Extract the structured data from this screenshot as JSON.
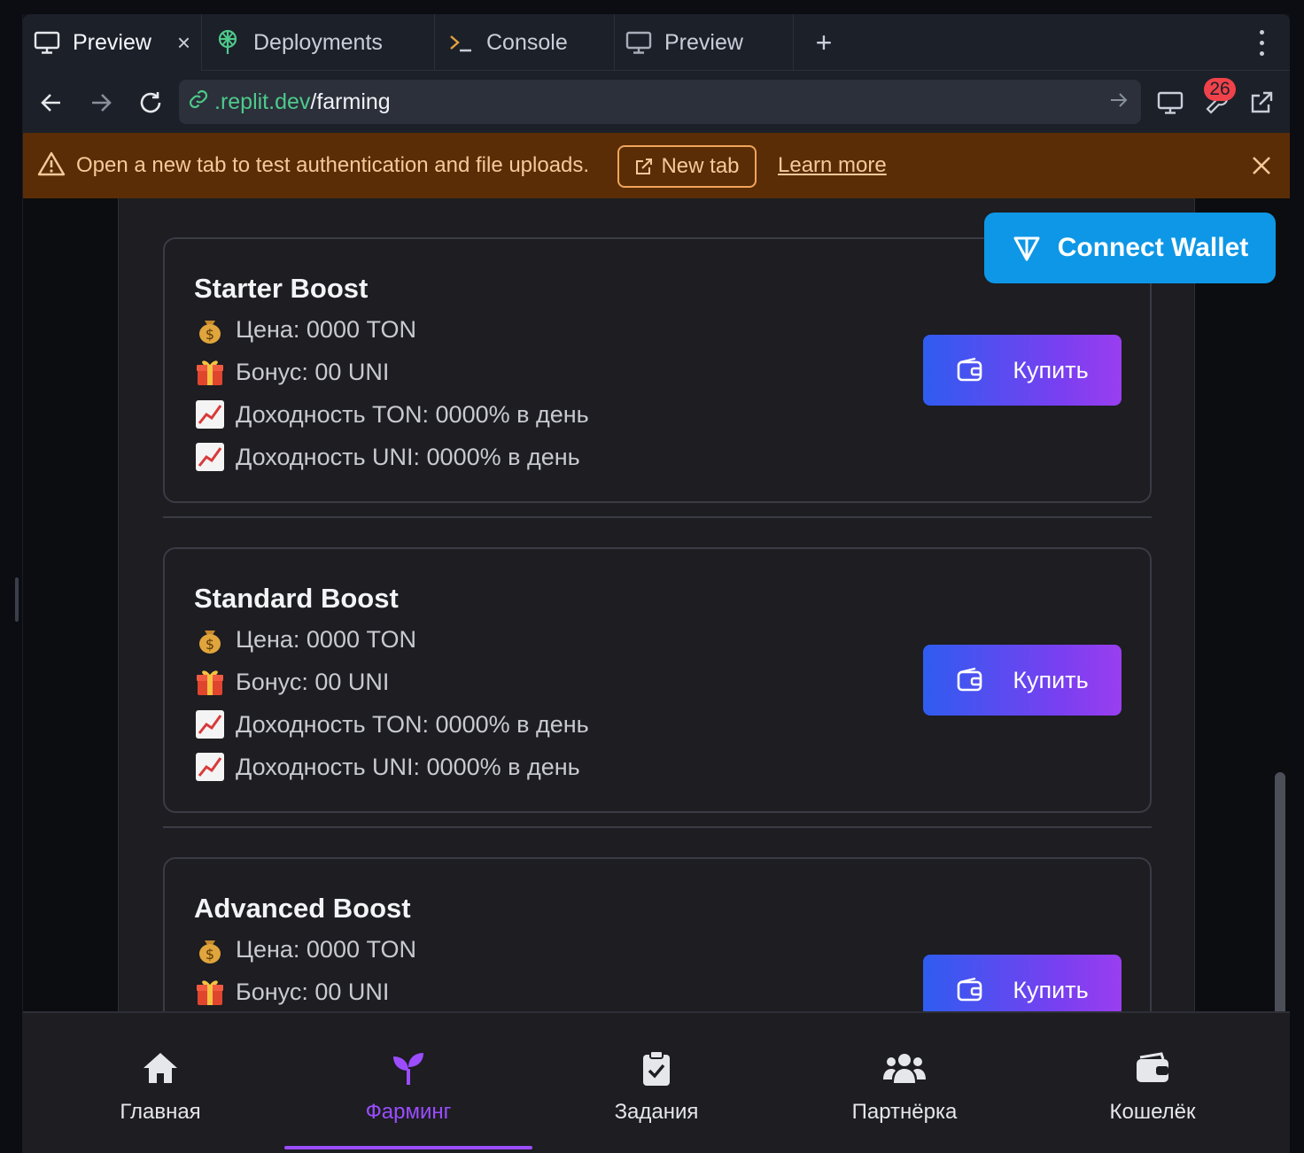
{
  "ide": {
    "tabs": [
      {
        "label": "Preview",
        "icon": "monitor-icon",
        "active": true
      },
      {
        "label": "Deployments",
        "icon": "deployments-icon"
      },
      {
        "label": "Console",
        "icon": "terminal-icon"
      },
      {
        "label": "Preview",
        "icon": "monitor-icon"
      }
    ],
    "close_symbol": "×",
    "plus_symbol": "+",
    "url": {
      "domain": ".replit.dev",
      "path": "/farming"
    },
    "notification_count": "26",
    "banner": {
      "message": "Open a new tab to test authentication and file uploads.",
      "new_tab": "New tab",
      "learn_more": "Learn more"
    }
  },
  "app": {
    "connect_wallet": "Connect Wallet",
    "buy_label": "Купить",
    "boosts": [
      {
        "title": "Starter Boost",
        "price": "Цена: 0000 TON",
        "bonus": "Бонус: 00 UNI",
        "yield_ton": "Доходность TON: 0000% в день",
        "yield_uni": "Доходность UNI: 0000% в день"
      },
      {
        "title": "Standard Boost",
        "price": "Цена: 0000 TON",
        "bonus": "Бонус: 00 UNI",
        "yield_ton": "Доходность TON: 0000% в день",
        "yield_uni": "Доходность UNI: 0000% в день"
      },
      {
        "title": "Advanced Boost",
        "price": "Цена: 0000 TON",
        "bonus": "Бонус: 00 UNI"
      }
    ],
    "nav": [
      {
        "label": "Главная",
        "icon": "home-icon"
      },
      {
        "label": "Фарминг",
        "icon": "sprout-icon",
        "active": true
      },
      {
        "label": "Задания",
        "icon": "clipboard-check-icon"
      },
      {
        "label": "Партнёрка",
        "icon": "users-icon"
      },
      {
        "label": "Кошелёк",
        "icon": "wallet-icon"
      }
    ],
    "colors": {
      "accent": "#9b4dff",
      "wallet_button": "#0e97e6",
      "buy_gradient_start": "#2f5cf0",
      "buy_gradient_end": "#9a3ef0"
    }
  }
}
